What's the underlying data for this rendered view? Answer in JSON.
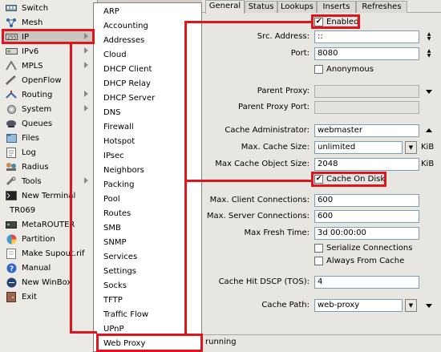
{
  "left_menu": {
    "items": [
      {
        "label": "Switch",
        "icon": "switch-icon",
        "arrow": false
      },
      {
        "label": "Mesh",
        "icon": "mesh-icon",
        "arrow": false
      },
      {
        "label": "IP",
        "icon": "ip-icon",
        "arrow": true,
        "selected": true
      },
      {
        "label": "IPv6",
        "icon": "ipv6-icon",
        "arrow": true
      },
      {
        "label": "MPLS",
        "icon": "mpls-icon",
        "arrow": true
      },
      {
        "label": "OpenFlow",
        "icon": "openflow-icon",
        "arrow": false
      },
      {
        "label": "Routing",
        "icon": "routing-icon",
        "arrow": true
      },
      {
        "label": "System",
        "icon": "system-icon",
        "arrow": true
      },
      {
        "label": "Queues",
        "icon": "queues-icon",
        "arrow": false
      },
      {
        "label": "Files",
        "icon": "files-icon",
        "arrow": false
      },
      {
        "label": "Log",
        "icon": "log-icon",
        "arrow": false
      },
      {
        "label": "Radius",
        "icon": "radius-icon",
        "arrow": false
      },
      {
        "label": "Tools",
        "icon": "tools-icon",
        "arrow": true
      },
      {
        "label": "New Terminal",
        "icon": "terminal-icon",
        "arrow": false
      },
      {
        "label": "TR069",
        "icon": "",
        "arrow": false
      },
      {
        "label": "MetaROUTER",
        "icon": "metarouter-icon",
        "arrow": false
      },
      {
        "label": "Partition",
        "icon": "partition-icon",
        "arrow": false
      },
      {
        "label": "Make Supout.rif",
        "icon": "supout-icon",
        "arrow": false
      },
      {
        "label": "Manual",
        "icon": "manual-icon",
        "arrow": false
      },
      {
        "label": "New WinBox",
        "icon": "winbox-icon",
        "arrow": false
      },
      {
        "label": "Exit",
        "icon": "exit-icon",
        "arrow": false
      }
    ]
  },
  "submenu": {
    "items": [
      "ARP",
      "Accounting",
      "Addresses",
      "Cloud",
      "DHCP Client",
      "DHCP Relay",
      "DHCP Server",
      "DNS",
      "Firewall",
      "Hotspot",
      "IPsec",
      "Neighbors",
      "Packing",
      "Pool",
      "Routes",
      "SMB",
      "SNMP",
      "Services",
      "Settings",
      "Socks",
      "TFTP",
      "Traffic Flow",
      "UPnP",
      "Web Proxy"
    ],
    "highlighted": "Web Proxy"
  },
  "tabs": [
    {
      "label": "General",
      "active": true
    },
    {
      "label": "Status",
      "active": false
    },
    {
      "label": "Lookups",
      "active": false
    },
    {
      "label": "Inserts",
      "active": false
    },
    {
      "label": "Refreshes",
      "active": false
    }
  ],
  "form": {
    "enabled": {
      "label": "Enabled",
      "checked": true
    },
    "src_address": {
      "label": "Src. Address:",
      "value": "::"
    },
    "port": {
      "label": "Port:",
      "value": "8080"
    },
    "anonymous": {
      "label": "Anonymous",
      "checked": false
    },
    "parent_proxy": {
      "label": "Parent Proxy:",
      "value": ""
    },
    "parent_proxy_port": {
      "label": "Parent Proxy Port:",
      "value": ""
    },
    "cache_admin": {
      "label": "Cache Administrator:",
      "value": "webmaster"
    },
    "max_cache_size": {
      "label": "Max. Cache Size:",
      "value": "unlimited",
      "unit": "KiB"
    },
    "max_cache_object_size": {
      "label": "Max Cache Object Size:",
      "value": "2048",
      "unit": "KiB"
    },
    "cache_on_disk": {
      "label": "Cache On Disk",
      "checked": true
    },
    "max_client_conn": {
      "label": "Max. Client Connections:",
      "value": "600"
    },
    "max_server_conn": {
      "label": "Max. Server Connections:",
      "value": "600"
    },
    "max_fresh_time": {
      "label": "Max Fresh Time:",
      "value": "3d 00:00:00"
    },
    "serialize_conn": {
      "label": "Serialize Connections",
      "checked": false
    },
    "always_from_cache": {
      "label": "Always From Cache",
      "checked": false
    },
    "cache_hit_dscp": {
      "label": "Cache Hit DSCP (TOS):",
      "value": "4"
    },
    "cache_path": {
      "label": "Cache Path:",
      "value": "web-proxy"
    }
  },
  "status": {
    "text": "running"
  },
  "colors": {
    "highlight": "#e0141c",
    "menu_bg": "#eceae4",
    "panel_bg": "#e8e6e0"
  }
}
